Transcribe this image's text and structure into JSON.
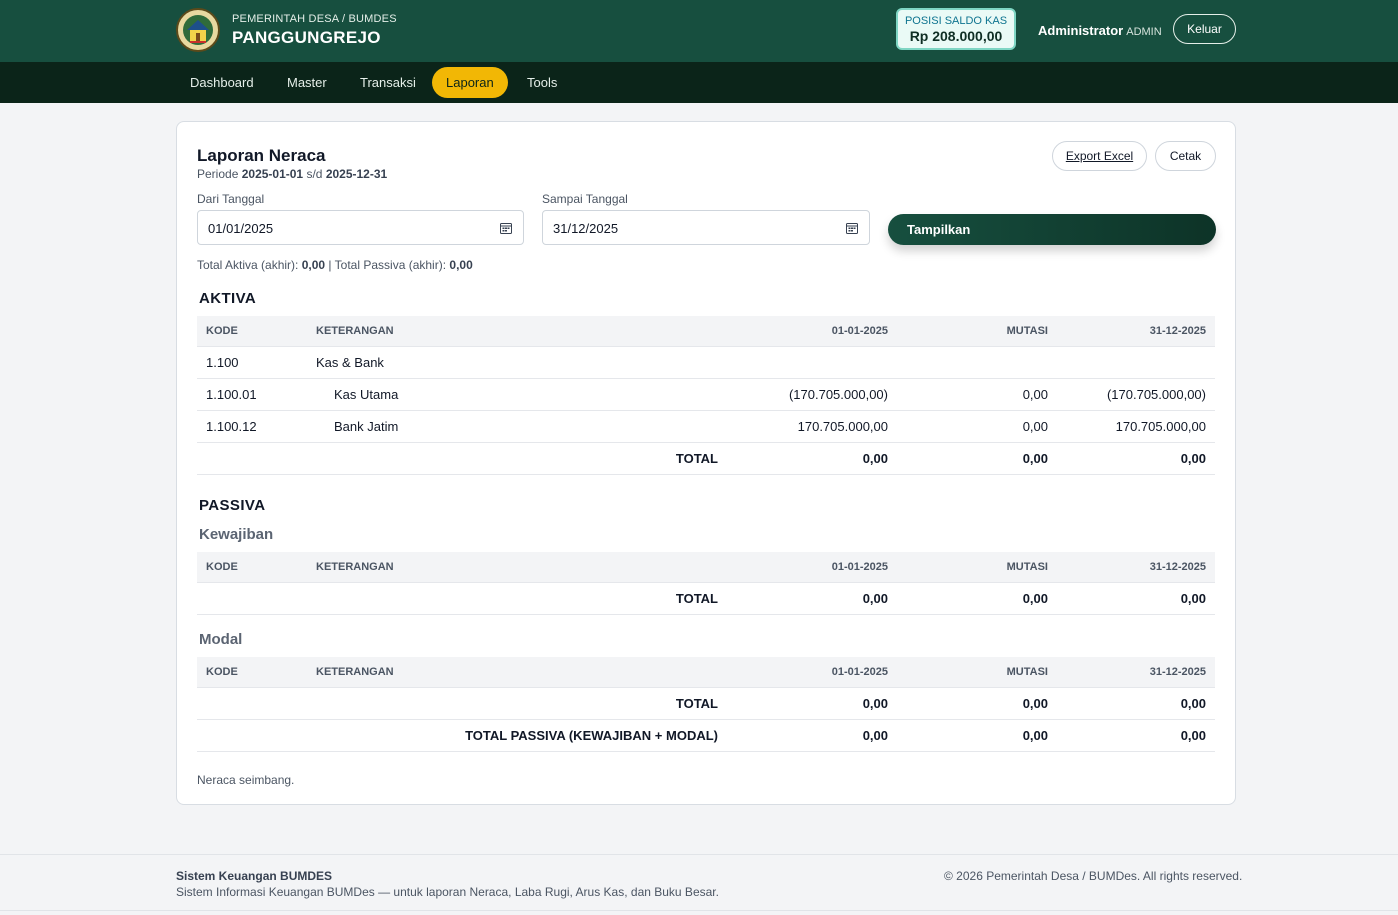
{
  "header": {
    "brand_sub": "PEMERINTAH DESA / BUMDES",
    "brand_title": "PANGGUNGREJO",
    "saldo_label": "POSISI SALDO KAS",
    "saldo_value": "Rp 208.000,00",
    "user_name": "Administrator",
    "user_role": "ADMIN",
    "logout_label": "Keluar"
  },
  "nav": {
    "items": [
      {
        "label": "Dashboard",
        "active": false
      },
      {
        "label": "Master",
        "active": false
      },
      {
        "label": "Transaksi",
        "active": false
      },
      {
        "label": "Laporan",
        "active": true
      },
      {
        "label": "Tools",
        "active": false
      }
    ]
  },
  "report": {
    "title": "Laporan Neraca",
    "periode_prefix": "Periode",
    "periode_start": "2025-01-01",
    "periode_sep": "s/d",
    "periode_end": "2025-12-31",
    "export_label": "Export Excel",
    "print_label": "Cetak",
    "from_label": "Dari Tanggal",
    "from_value": "01/01/2025",
    "to_label": "Sampai Tanggal",
    "to_value": "31/12/2025",
    "show_label": "Tampilkan",
    "summary_aktiva_label": "Total Aktiva (akhir):",
    "summary_aktiva_value": "0,00",
    "summary_sep": "|",
    "summary_passiva_label": "Total Passiva (akhir):",
    "summary_passiva_value": "0,00",
    "note": "Neraca seimbang."
  },
  "columns": {
    "kode": "KODE",
    "keterangan": "KETERANGAN",
    "start": "01-01-2025",
    "mutasi": "MUTASI",
    "end": "31-12-2025"
  },
  "aktiva": {
    "title": "AKTIVA",
    "rows": [
      {
        "kode": "1.100",
        "keterangan": "Kas & Bank",
        "start": "",
        "mutasi": "",
        "end": ""
      },
      {
        "kode": "1.100.01",
        "keterangan": "Kas Utama",
        "start": "(170.705.000,00)",
        "mutasi": "0,00",
        "end": "(170.705.000,00)"
      },
      {
        "kode": "1.100.12",
        "keterangan": "Bank Jatim",
        "start": "170.705.000,00",
        "mutasi": "0,00",
        "end": "170.705.000,00"
      }
    ],
    "total": {
      "label": "TOTAL",
      "start": "0,00",
      "mutasi": "0,00",
      "end": "0,00"
    }
  },
  "passiva": {
    "title": "PASSIVA",
    "kewajiban": {
      "title": "Kewajiban",
      "total": {
        "label": "TOTAL",
        "start": "0,00",
        "mutasi": "0,00",
        "end": "0,00"
      }
    },
    "modal": {
      "title": "Modal",
      "total": {
        "label": "TOTAL",
        "start": "0,00",
        "mutasi": "0,00",
        "end": "0,00"
      }
    },
    "grand_total": {
      "label": "TOTAL PASSIVA (KEWAJIBAN + MODAL)",
      "start": "0,00",
      "mutasi": "0,00",
      "end": "0,00"
    }
  },
  "footer": {
    "title": "Sistem Keuangan BUMDES",
    "desc": "Sistem Informasi Keuangan BUMDes — untuk laporan Neraca, Laba Rugi, Arus Kas, dan Buku Besar.",
    "copyright": "© 2026 Pemerintah Desa / BUMDes. All rights reserved."
  },
  "colors": {
    "header_bg": "#174f3f",
    "nav_bg": "#0b2419",
    "active_nav": "#f2b705",
    "primary_button": "#174f3f"
  },
  "icons": {
    "logo": "village-emblem-icon",
    "date": "calendar-icon"
  }
}
